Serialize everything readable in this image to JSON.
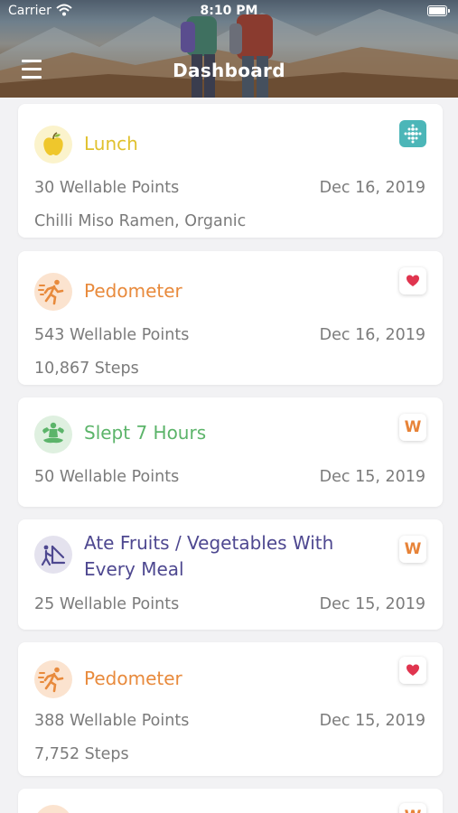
{
  "status_bar": {
    "carrier": "Carrier",
    "time": "8:10 PM"
  },
  "header": {
    "title": "Dashboard",
    "menu_icon": "hamburger-menu-icon"
  },
  "activities": [
    {
      "title": "Lunch",
      "title_color": "#e0c12e",
      "icon": "apple-icon",
      "source": "fitbit-logo-icon",
      "points": "30 Wellable Points",
      "date": "Dec 16, 2019",
      "detail": "Chilli Miso Ramen, Organic"
    },
    {
      "title": "Pedometer",
      "title_color": "#e88a3c",
      "icon": "runner-icon",
      "source": "apple-health-heart-icon",
      "points": "543 Wellable Points",
      "date": "Dec 16, 2019",
      "detail": "10,867 Steps"
    },
    {
      "title": "Slept 7 Hours",
      "title_color": "#5cb46a",
      "icon": "meditation-icon",
      "source": "wellable-logo-icon",
      "source_text": "W",
      "points": "50 Wellable Points",
      "date": "Dec 15, 2019"
    },
    {
      "title_line1": "Ate Fruits / Vegetables With",
      "title_line2": "Every Meal",
      "title_color": "#4e4890",
      "icon": "activity-person-icon",
      "source": "wellable-logo-icon",
      "source_text": "W",
      "points": "25 Wellable Points",
      "date": "Dec 15, 2019"
    },
    {
      "title": "Pedometer",
      "title_color": "#e88a3c",
      "icon": "runner-icon",
      "source": "apple-health-heart-icon",
      "points": "388 Wellable Points",
      "date": "Dec 15, 2019",
      "detail": "7,752 Steps"
    },
    {
      "source": "wellable-logo-icon",
      "source_text": "W"
    }
  ],
  "colors": {
    "background": "#f2f2f4",
    "text_muted": "#7b7b7b",
    "fitbit": "#4cb6b8",
    "heart": "#e0354f",
    "wellable": "#e78338"
  }
}
